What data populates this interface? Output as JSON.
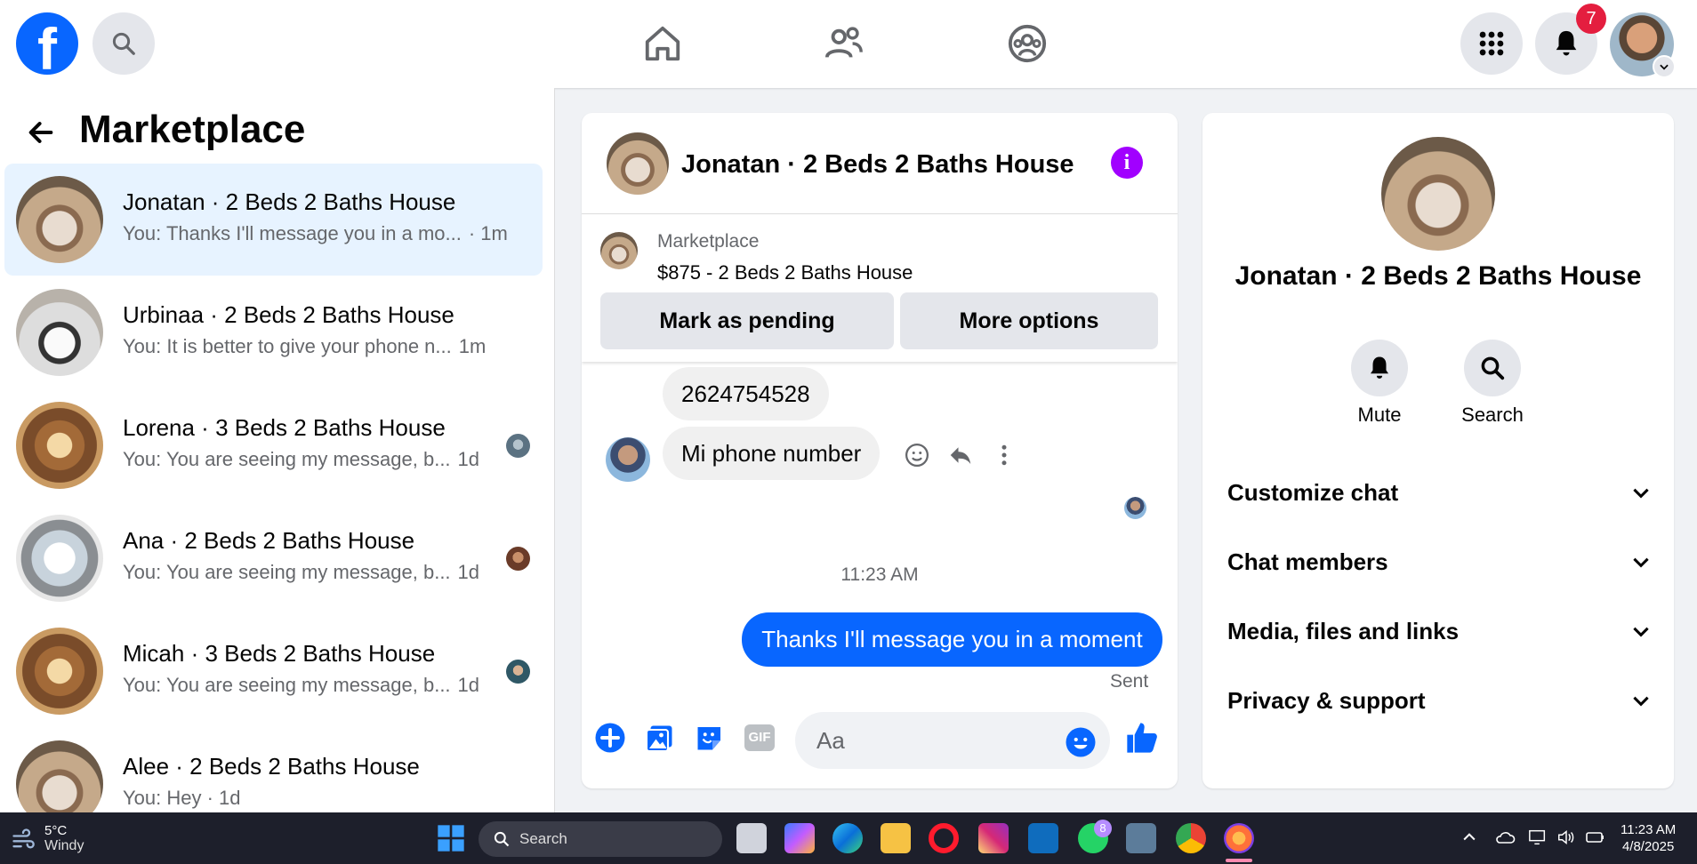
{
  "topbar": {
    "logo_letter": "f",
    "notifications_count": "7",
    "icons": [
      "facebook-logo",
      "search-icon",
      "home-icon",
      "friends-icon",
      "groups-icon",
      "menu-grid-icon",
      "bell-icon",
      "profile-avatar",
      "chevron-down-icon"
    ]
  },
  "sidebar": {
    "title": "Marketplace",
    "conversations": [
      {
        "name": "Jonatan · 2 Beds 2 Baths House",
        "preview": "You: Thanks I'll message you in a mo...",
        "time": "· 1m",
        "active": true
      },
      {
        "name": "Urbinaa · 2 Beds 2 Baths House",
        "preview": "You: It is better to give your phone n...",
        "time": "1m",
        "active": false
      },
      {
        "name": "Lorena · 3 Beds 2 Baths House",
        "preview": "You: You are seeing my message, b...",
        "time": "1d",
        "active": false
      },
      {
        "name": "Ana · 2 Beds 2 Baths House",
        "preview": "You: You are seeing my message, b...",
        "time": "1d",
        "active": false
      },
      {
        "name": "Micah · 3 Beds 2 Baths House",
        "preview": "You: You are seeing my message, b...",
        "time": "1d",
        "active": false
      },
      {
        "name": "Alee · 2 Beds 2 Baths House",
        "preview": "You: Hey · 1d",
        "time": "",
        "active": false
      }
    ]
  },
  "chat": {
    "title": "Jonatan · 2 Beds 2 Baths House",
    "listing_label": "Marketplace",
    "listing_price": "$875 - 2 Beds 2 Baths House",
    "mark_pending_label": "Mark as pending",
    "more_options_label": "More options",
    "messages_in": [
      "2624754528",
      "Mi phone number"
    ],
    "timestamp": "11:23 AM",
    "message_out": "Thanks I'll message you in a moment",
    "sent_status": "Sent",
    "input_placeholder": "Aa",
    "gif_label": "GIF"
  },
  "details": {
    "title": "Jonatan · 2 Beds 2 Baths House",
    "mute_label": "Mute",
    "search_label": "Search",
    "sections": [
      "Customize chat",
      "Chat members",
      "Media, files and links",
      "Privacy & support"
    ]
  },
  "taskbar": {
    "temperature": "5°C",
    "weather": "Windy",
    "search_label": "Search",
    "whatsapp_badge": "8",
    "clock_time": "11:23 AM",
    "clock_date": "4/8/2025"
  },
  "colors": {
    "accent": "#0866ff",
    "info": "#a100ff",
    "badge": "#e41e3f"
  }
}
